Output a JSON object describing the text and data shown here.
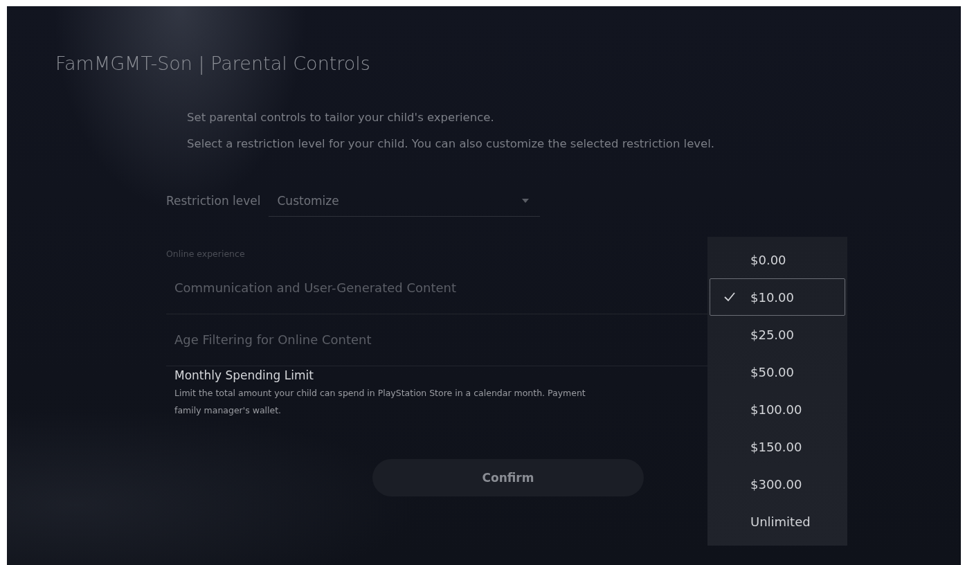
{
  "title": "FamMGMT-Son | Parental Controls",
  "intro": [
    "Set parental controls to tailor your child's experience.",
    "Select a restriction level for your child. You can also customize the selected restriction level."
  ],
  "restriction": {
    "label": "Restriction level",
    "value": "Customize"
  },
  "section_label": "Online experience",
  "settings": [
    {
      "title": "Communication and User-Generated Content",
      "focused": false
    },
    {
      "title": "Age Filtering for Online Content",
      "focused": false
    },
    {
      "title": "Monthly Spending Limit",
      "focused": true,
      "description": [
        "Limit the total amount your child can spend in PlayStation Store in a calendar month. Payment",
        "family manager's wallet."
      ]
    }
  ],
  "confirm": {
    "label": "Confirm",
    "disabled": true
  },
  "dropdown": {
    "options": [
      {
        "label": "$0.00",
        "selected": false
      },
      {
        "label": "$10.00",
        "selected": true
      },
      {
        "label": "$25.00",
        "selected": false
      },
      {
        "label": "$50.00",
        "selected": false
      },
      {
        "label": "$100.00",
        "selected": false
      },
      {
        "label": "$150.00",
        "selected": false
      },
      {
        "label": "$300.00",
        "selected": false
      },
      {
        "label": "Unlimited",
        "selected": false
      }
    ]
  }
}
